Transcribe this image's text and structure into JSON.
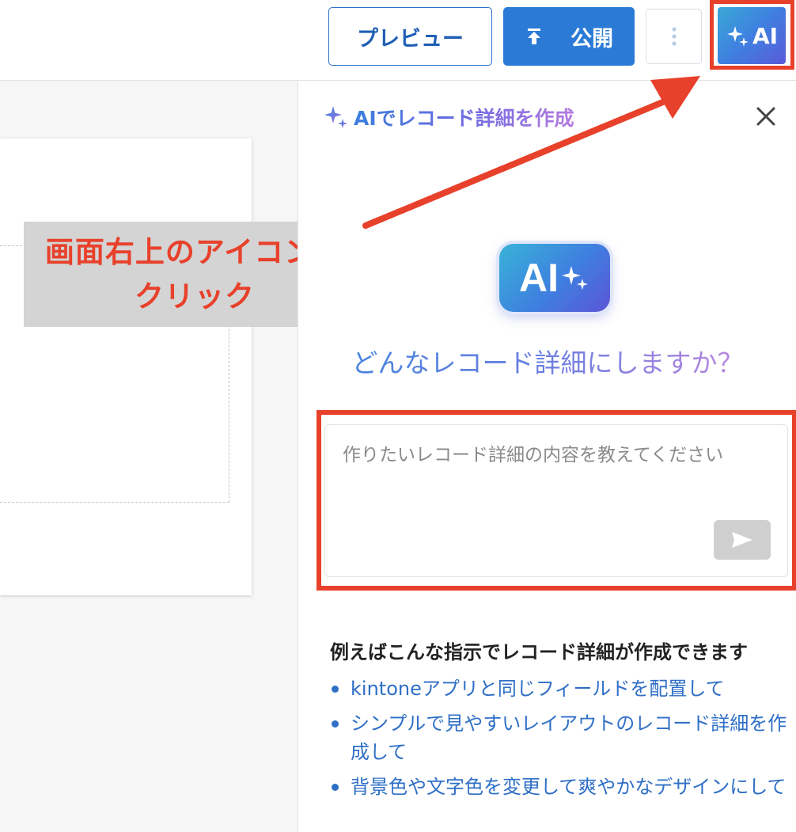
{
  "toolbar": {
    "preview_label": "プレビュー",
    "publish_label": "公開",
    "ai_label": "AI"
  },
  "annotation": {
    "line1": "画面右上のアイコンを",
    "line2": "クリック"
  },
  "panel": {
    "title": "AIでレコード詳細を作成",
    "logo_text": "AI",
    "question": "どんなレコード詳細にしますか？",
    "prompt_placeholder": "作りたいレコード詳細の内容を教えてください",
    "examples_heading": "例えばこんな指示でレコード詳細が作成できます",
    "examples": [
      "kintoneアプリと同じフィールドを配置して",
      "シンプルで見やすいレイアウトのレコード詳細を作成して",
      "背景色や文字色を変更して爽やかなデザインにして"
    ]
  },
  "colors": {
    "accent_blue": "#2b7bd6",
    "annotation_red": "#e8412b",
    "link_blue": "#2f6fc6"
  },
  "icons": [
    "upload-icon",
    "more-vertical-icon",
    "sparkle-icon",
    "close-icon",
    "send-icon"
  ]
}
